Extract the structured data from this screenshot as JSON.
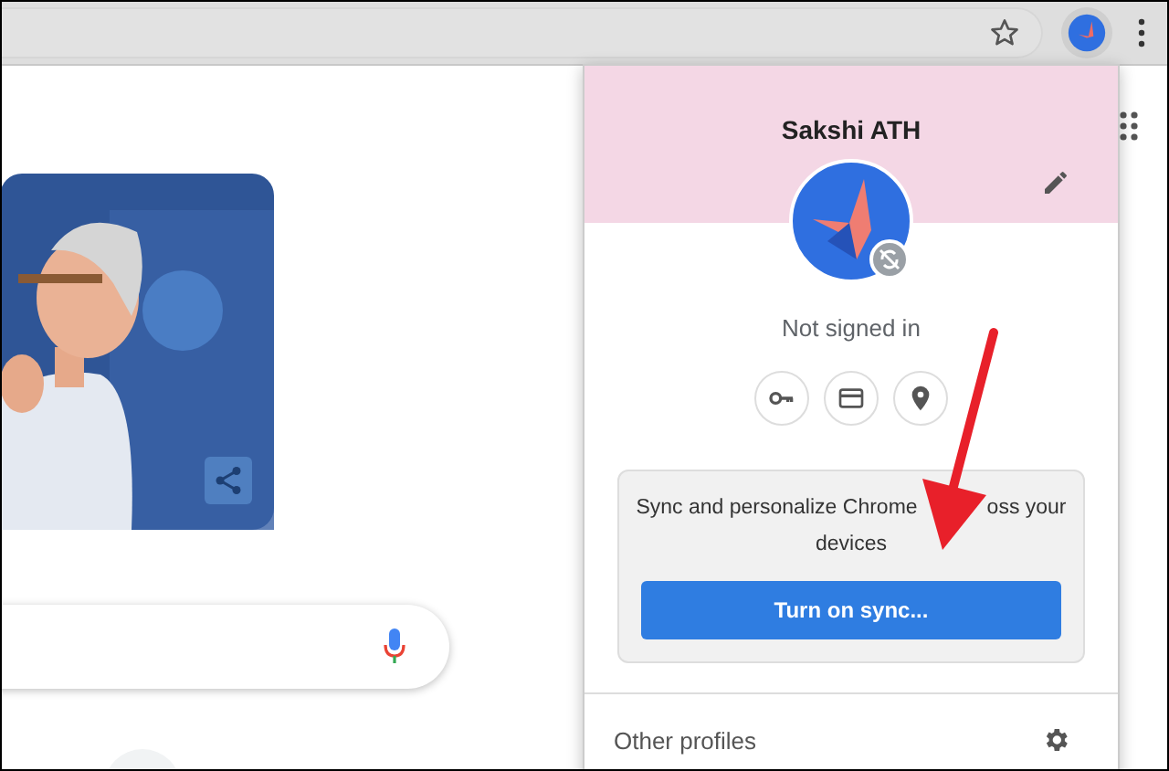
{
  "profile_menu": {
    "name": "Sakshi ATH",
    "status": "Not signed in",
    "sync_text": [
      "Sync and personalize Chrome",
      "oss your",
      "devices"
    ],
    "sync_button": "Turn on sync...",
    "other_profiles": "Other profiles"
  }
}
